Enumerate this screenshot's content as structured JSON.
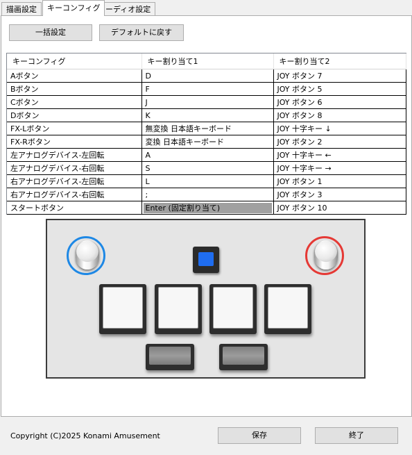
{
  "tabs": [
    {
      "label": "描画設定"
    },
    {
      "label": "キーコンフィグ"
    },
    {
      "label": "オーディオ設定"
    }
  ],
  "active_tab": "キーコンフィグ",
  "toolbar": {
    "bulk_label": "一括設定",
    "default_label": "デフォルトに戻す"
  },
  "table": {
    "columns": [
      "キーコンフィグ",
      "キー割り当て1",
      "キー割り当て2"
    ],
    "rows": [
      {
        "name": "Aボタン",
        "key1": "D",
        "key2": "JOY ボタン 7"
      },
      {
        "name": "Bボタン",
        "key1": "F",
        "key2": "JOY ボタン 5"
      },
      {
        "name": "Cボタン",
        "key1": "J",
        "key2": "JOY ボタン 6"
      },
      {
        "name": "Dボタン",
        "key1": "K",
        "key2": "JOY ボタン 8"
      },
      {
        "name": "FX-Lボタン",
        "key1": "無変換 日本語キーボード",
        "key2": "JOY 十字キー ↓"
      },
      {
        "name": "FX-Rボタン",
        "key1": "変換 日本語キーボード",
        "key2": "JOY ボタン 2"
      },
      {
        "name": "左アナログデバイス-左回転",
        "key1": "A",
        "key2": "JOY 十字キー ←"
      },
      {
        "name": "左アナログデバイス-右回転",
        "key1": "S",
        "key2": "JOY 十字キー →"
      },
      {
        "name": "右アナログデバイス-左回転",
        "key1": "L",
        "key2": "JOY ボタン 1"
      },
      {
        "name": "右アナログデバイス-右回転",
        "key1": ";",
        "key2": "JOY ボタン 3"
      },
      {
        "name": "スタートボタン",
        "key1": "Enter (固定割り当て)",
        "key2": "JOY ボタン 10",
        "key1_fixed": true
      }
    ]
  },
  "controller": {
    "left_knob_color": "#1e88e5",
    "right_knob_color": "#e53935",
    "start_color": "#1f6df0"
  },
  "footer": {
    "copyright": "Copyright (C)2025 Konami Amusement",
    "save_label": "保存",
    "exit_label": "終了"
  }
}
